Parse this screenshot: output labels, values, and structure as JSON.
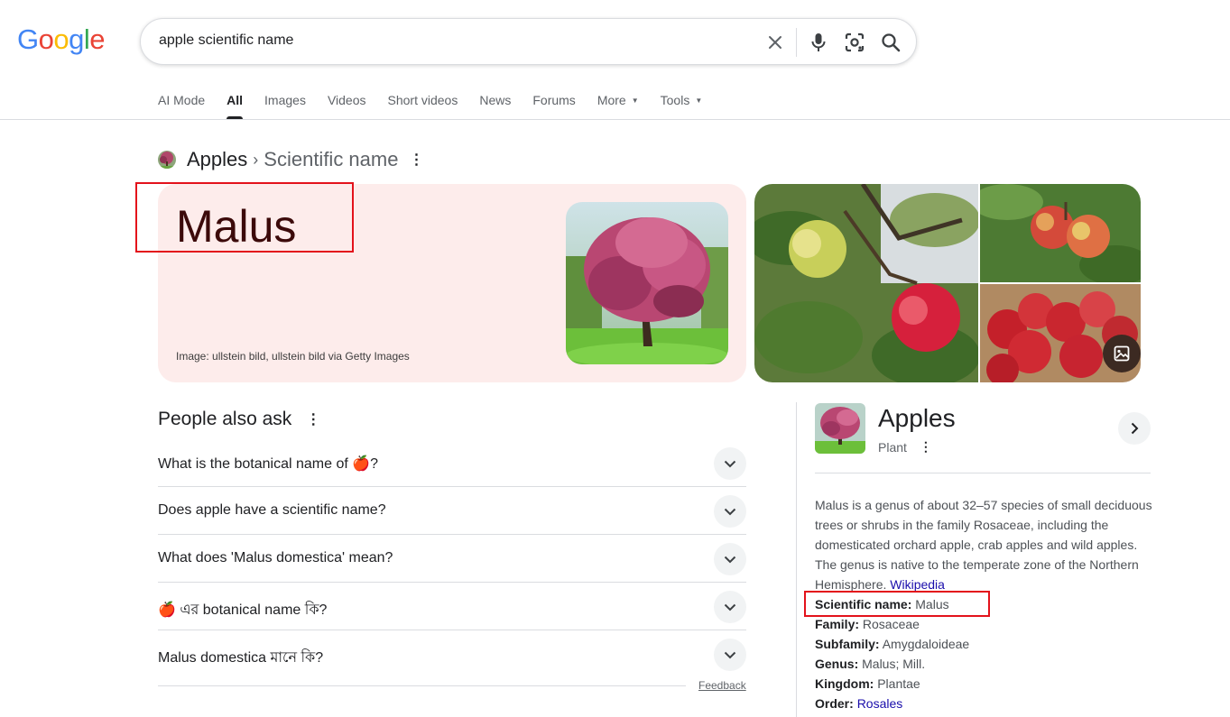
{
  "logo": {
    "letters": [
      "G",
      "o",
      "o",
      "g",
      "l",
      "e"
    ],
    "colors": [
      "#4285f4",
      "#ea4335",
      "#fbbc05",
      "#4285f4",
      "#34a853",
      "#ea4335"
    ]
  },
  "search": {
    "query": "apple scientific name"
  },
  "tabs": [
    {
      "label": "AI Mode"
    },
    {
      "label": "All"
    },
    {
      "label": "Images"
    },
    {
      "label": "Videos"
    },
    {
      "label": "Short videos"
    },
    {
      "label": "News"
    },
    {
      "label": "Forums"
    },
    {
      "label": "More"
    },
    {
      "label": "Tools"
    }
  ],
  "breadcrumb": {
    "main": "Apples",
    "separator": "›",
    "sub": "Scientific name"
  },
  "answer": {
    "title": "Malus",
    "credit": "Image: ullstein bild, ullstein bild via Getty Images"
  },
  "paa": {
    "title": "People also ask",
    "questions": [
      {
        "before": "What is the botanical name of ",
        "emoji": "🍎",
        "after": "?"
      },
      {
        "before": "Does apple have a scientific name?",
        "emoji": "",
        "after": ""
      },
      {
        "before": "What does 'Malus domestica' mean?",
        "emoji": "",
        "after": ""
      },
      {
        "before": "",
        "emoji": "🍎",
        "after": " এর botanical name কি?"
      },
      {
        "before": "Malus domestica মানে কি?",
        "emoji": "",
        "after": ""
      }
    ],
    "feedback": "Feedback"
  },
  "kp": {
    "title": "Apples",
    "subtitle": "Plant",
    "description": "Malus is a genus of about 32–57 species of small deciduous trees or shrubs in the family Rosaceae, including the domesticated orchard apple, crab apples and wild apples. The genus is native to the temperate zone of the Northern Hemisphere.",
    "source": "Wikipedia",
    "facts": [
      {
        "label": "Scientific name:",
        "value": "Malus",
        "link": false
      },
      {
        "label": "Family:",
        "value": "Rosaceae",
        "link": false
      },
      {
        "label": "Subfamily:",
        "value": "Amygdaloideae",
        "link": false
      },
      {
        "label": "Genus:",
        "value": "Malus; Mill.",
        "link": false
      },
      {
        "label": "Kingdom:",
        "value": "Plantae",
        "link": false
      },
      {
        "label": "Order:",
        "value": "Rosales",
        "link": true
      }
    ]
  },
  "colors": {
    "accent_red_box": "#e3121b",
    "answer_bg": "#fdeceb",
    "link": "#1a0dab"
  }
}
